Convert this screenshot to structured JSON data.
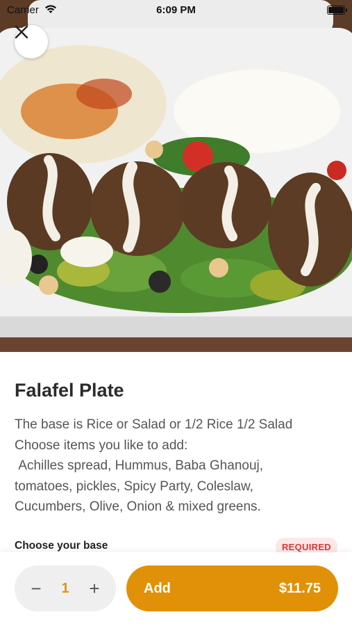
{
  "status_bar": {
    "carrier": "Carrier",
    "time": "6:09 PM",
    "wifi_icon": "wifi-icon",
    "battery_icon": "battery-icon"
  },
  "hero": {
    "image": "falafel-plate-photo",
    "close_icon": "close-icon"
  },
  "item": {
    "title": "Falafel Plate",
    "description": "The base is Rice or Salad or 1/2 Rice 1/2 Salad\nChoose items you like to add:\n Achilles spread, Hummus, Baba Ghanouj,\ntomatoes, pickles, Spicy Party, Coleslaw,\nCucumbers, Olive, Onion & mixed greens."
  },
  "options": {
    "section_label": "Choose your base",
    "required_label": "REQUIRED"
  },
  "cart": {
    "minus_symbol": "−",
    "quantity": "1",
    "plus_symbol": "+",
    "add_label": "Add",
    "price": "$11.75"
  },
  "colors": {
    "accent": "#e19108",
    "required_bg": "#fde8e8",
    "required_text": "#d93838"
  }
}
